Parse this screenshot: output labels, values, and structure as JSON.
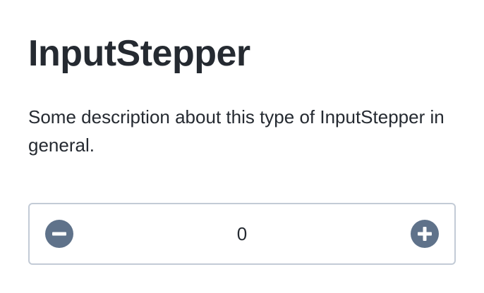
{
  "page": {
    "title": "InputStepper",
    "description": "Some description about this type of InputStepper in general."
  },
  "stepper": {
    "value": "0",
    "decrement_icon": "minus-circle-icon",
    "increment_icon": "plus-circle-icon",
    "icon_color": "#5f728a",
    "border_color": "#c3cbd6"
  }
}
